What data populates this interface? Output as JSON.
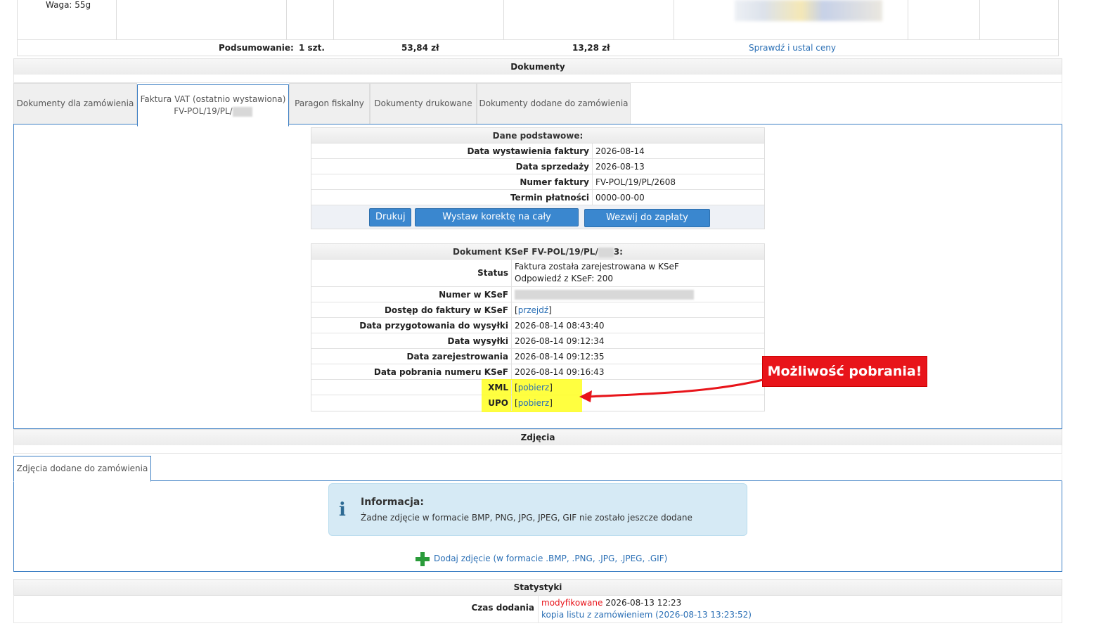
{
  "product": {
    "weight": "Waga: 55g"
  },
  "summary": {
    "label": "Podsumowanie:",
    "qty": "1 szt.",
    "total": "53,84 zł",
    "vat": "13,28 zł",
    "check_link": "Sprawdź i ustal ceny"
  },
  "documents": {
    "header": "Dokumenty",
    "tabs": [
      {
        "label": "Dokumenty dla zamówienia"
      },
      {
        "label": "Faktura VAT (ostatnio wystawiona)",
        "sub": "FV-POL/19/PL/"
      },
      {
        "label": "Paragon fiskalny"
      },
      {
        "label": "Dokumenty drukowane"
      },
      {
        "label": "Dokumenty dodane do zamówienia"
      }
    ],
    "basic": {
      "title": "Dane podstawowe:",
      "rows": [
        {
          "label": "Data wystawienia faktury",
          "value": "2026-08-14"
        },
        {
          "label": "Data sprzedaży",
          "value": "2026-08-13"
        },
        {
          "label": "Numer faktury",
          "value": "FV-POL/19/PL/2608"
        },
        {
          "label": "Termin płatności",
          "value": "0000-00-00"
        }
      ],
      "buttons": {
        "print": "Drukuj",
        "correction": "Wystaw korektę na cały dokument",
        "payment_call": "Wezwij do zapłaty faktury"
      }
    },
    "ksef": {
      "title_prefix": "Dokument KSeF FV-POL/19/PL/",
      "title_suffix": "3:",
      "status_label": "Status",
      "status_line1": "Faktura została zarejestrowana w KSeF",
      "status_line2": "Odpowiedź z KSeF: 200",
      "number_label": "Numer w KSeF",
      "access_label": "Dostęp do faktury w KSeF",
      "access_link": "przejdź",
      "rows": [
        {
          "label": "Data przygotowania do wysyłki",
          "value": "2026-08-14 08:43:40"
        },
        {
          "label": "Data wysyłki",
          "value": "2026-08-14 09:12:34"
        },
        {
          "label": "Data zarejestrowania",
          "value": "2026-08-14 09:12:35"
        },
        {
          "label": "Data pobrania numeru KSeF",
          "value": "2026-08-14 09:16:43"
        }
      ],
      "xml_label": "XML",
      "upo_label": "UPO",
      "download_link": "pobierz"
    },
    "callout": "Możliwość pobrania!"
  },
  "photos": {
    "header": "Zdjęcia",
    "tab": "Zdjęcia dodane do zamówienia",
    "info_title": "Informacja:",
    "info_text": "Żadne zdjęcie w formacie BMP, PNG, JPG, JPEG, GIF nie zostało jeszcze dodane",
    "add_link": "Dodaj zdjęcie (w formacie .BMP, .PNG, .JPG, .JPEG, .GIF)"
  },
  "stats": {
    "header": "Statystyki",
    "added_label": "Czas dodania",
    "modified": "modyfikowane",
    "modified_date": "2026-08-13 12:23",
    "copy_link": "kopia listu z zamówieniem (2026-08-13 13:23:52)"
  },
  "colors": {
    "accent": "#3a87cf",
    "highlight": "#ffff1e",
    "callout": "#e8141a",
    "modified": "#e8141a"
  }
}
